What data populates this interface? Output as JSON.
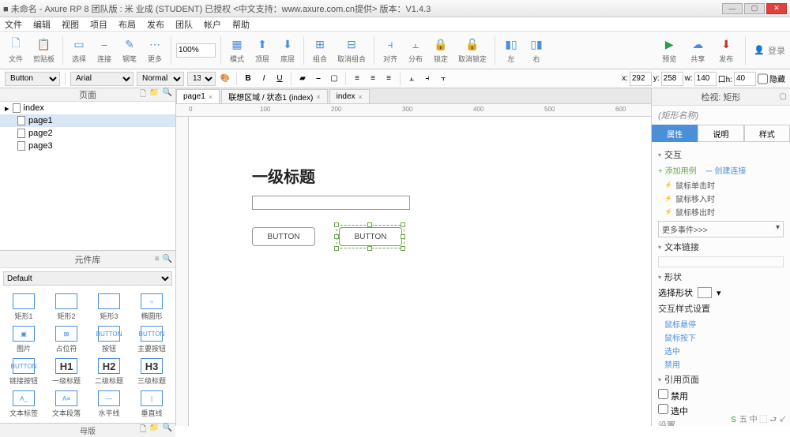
{
  "title": "■ 未命名 - Axure RP 8 团队版 : 米 业成 (STUDENT) 已授权   <中文支持：www.axure.com.cn提供>  版本：V1.4.3",
  "menu": [
    "文件",
    "编辑",
    "视图",
    "项目",
    "布局",
    "发布",
    "团队",
    "帐户",
    "帮助"
  ],
  "toolbar": {
    "file": "文件",
    "clipboard": "剪贴板",
    "select": "选择",
    "connect": "连接",
    "pen": "钢笔",
    "more": "更多",
    "zoom": "100%",
    "align_l": "模式",
    "align_t": "顶层",
    "align_b": "底层",
    "group": "组合",
    "ungroup": "取消组合",
    "dist": "对齐",
    "dist2": "分布",
    "lock": "锁定",
    "unlock": "取消锁定",
    "left": "左",
    "right": "右",
    "preview": "预览",
    "share": "共享",
    "publish": "发布",
    "login": "登录"
  },
  "stylebar": {
    "widget_type": "Button",
    "font": "Arial",
    "weight": "Normal",
    "size": "13",
    "x_lbl": "x:",
    "x": "292",
    "y_lbl": "y:",
    "y": "258",
    "w_lbl": "w:",
    "w": "140",
    "h_lbl": "口h:",
    "h": "40",
    "hidden": "隐藏"
  },
  "panels": {
    "pages_hdr": "页面",
    "lib_hdr": "元件库",
    "masters_hdr": "母版",
    "insp_hdr": "检视: 矩形"
  },
  "pages": {
    "root": "index",
    "items": [
      "page1",
      "page2",
      "page3"
    ],
    "selected": 0
  },
  "library": {
    "set": "Default",
    "items": [
      {
        "lbl": "矩形1",
        "sh": ""
      },
      {
        "lbl": "矩形2",
        "sh": ""
      },
      {
        "lbl": "矩形3",
        "sh": ""
      },
      {
        "lbl": "椭圆形",
        "sh": "○"
      },
      {
        "lbl": "图片",
        "sh": "▣"
      },
      {
        "lbl": "占位符",
        "sh": "⊠"
      },
      {
        "lbl": "按钮",
        "sh": "BUTTON"
      },
      {
        "lbl": "主要按钮",
        "sh": "BUTTON"
      },
      {
        "lbl": "链接按钮",
        "sh": "BUTTON"
      },
      {
        "lbl": "一级标题",
        "sh": "H1"
      },
      {
        "lbl": "二级标题",
        "sh": "H2"
      },
      {
        "lbl": "三级标题",
        "sh": "H3"
      },
      {
        "lbl": "文本标签",
        "sh": "A_"
      },
      {
        "lbl": "文本段落",
        "sh": "A≡"
      },
      {
        "lbl": "水平线",
        "sh": "—"
      },
      {
        "lbl": "垂直线",
        "sh": "|"
      }
    ]
  },
  "tabs": [
    {
      "label": "page1",
      "active": true
    },
    {
      "label": "联想区域 / 状态1 (index)",
      "active": false
    },
    {
      "label": "index",
      "active": false
    }
  ],
  "ruler_ticks": [
    0,
    100,
    200,
    300,
    400,
    500,
    600
  ],
  "canvas": {
    "heading": "一级标题",
    "button1": "BUTTON",
    "button2": "BUTTON"
  },
  "inspector": {
    "shape_name": "(矩形名称)",
    "tab_attr": "属性",
    "tab_note": "说明",
    "tab_style": "样式",
    "sect_inter": "交互",
    "add_case": "添加用例",
    "create_link": "创建连接",
    "events": [
      "鼠标单击时",
      "鼠标移入时",
      "鼠标移出时"
    ],
    "more_events": "更多事件>>>",
    "sect_textlink": "文本链接",
    "sect_shape": "形状",
    "select_shape": "选择形状",
    "sect_interstyle": "交互样式设置",
    "style_links": [
      "鼠标悬停",
      "鼠标按下",
      "选中",
      "禁用"
    ],
    "sect_ref": "引用页面",
    "chk1": "禁用",
    "chk2": "选中",
    "extra": "设置…"
  },
  "ime": "五 中 ⬚ ⮐ ↙"
}
